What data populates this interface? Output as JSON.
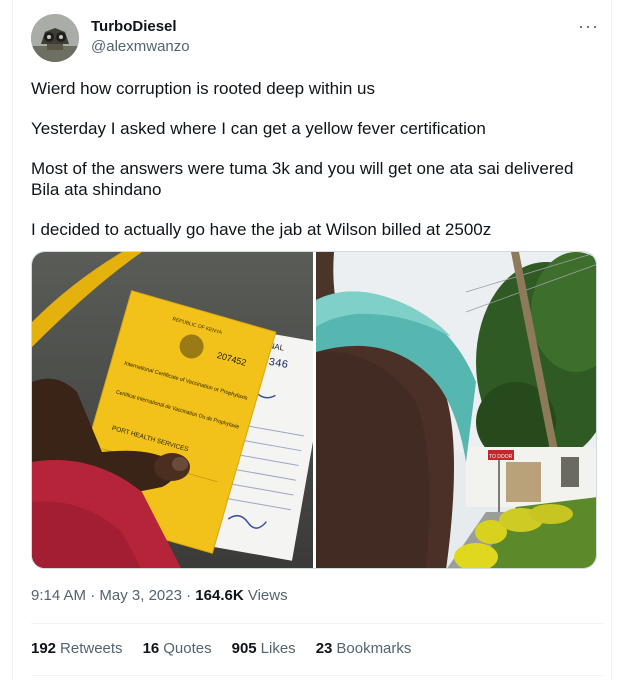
{
  "author": {
    "display_name": "TurboDiesel",
    "handle": "@alexmwanzo"
  },
  "more_icon": "more-horizontal-icon",
  "tweet": {
    "paragraphs": [
      "Wierd how corruption is rooted deep within us",
      "Yesterday I asked where I can get a yellow fever certification",
      "Most of the answers were tuma 3k and you will get one ata sai delivered Bila ata shindano",
      "I decided to actually go have the jab at Wilson billed at 2500z"
    ]
  },
  "media": {
    "certificate": {
      "republic": "REPUBLIC OF KENYA",
      "number": "207452",
      "title": "International Certificate of Vaccination or Prophylaxis",
      "subtitle": "Certificat International de Vaccination Ou de Prophylaxie",
      "service": "PORT HEALTH SERVICES",
      "receipt_label": "ORIGINAL",
      "receipt_number": "0086346"
    },
    "sign_text": "TO DOOR"
  },
  "meta": {
    "time": "9:14 AM",
    "sep1": " · ",
    "date": "May 3, 2023",
    "sep2": " · ",
    "views_count": "164.6K",
    "views_label": " Views"
  },
  "stats": {
    "retweets_count": "192",
    "retweets_label": "Retweets",
    "quotes_count": "16",
    "quotes_label": "Quotes",
    "likes_count": "905",
    "likes_label": "Likes",
    "bookmarks_count": "23",
    "bookmarks_label": "Bookmarks"
  }
}
